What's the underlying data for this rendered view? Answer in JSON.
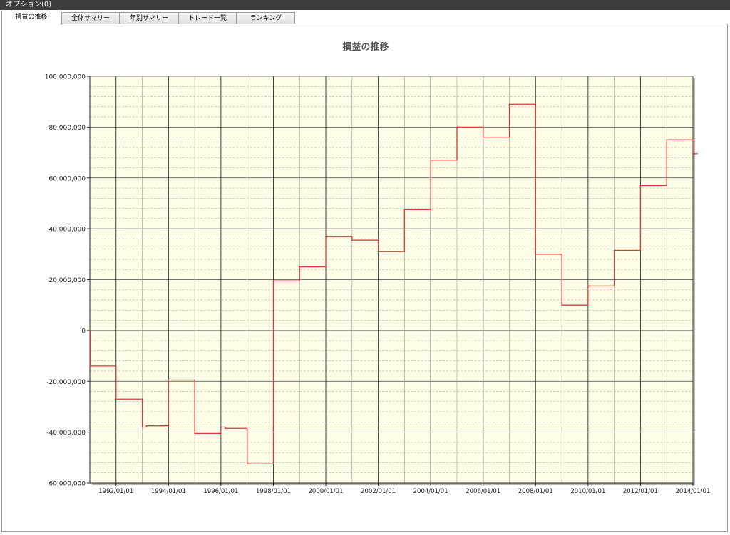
{
  "window": {
    "title": "オプション(0)"
  },
  "tabs": [
    {
      "label": "損益の推移",
      "active": true
    },
    {
      "label": "全体サマリー",
      "active": false
    },
    {
      "label": "年別サマリー",
      "active": false
    },
    {
      "label": "トレード一覧",
      "active": false
    },
    {
      "label": "ランキング",
      "active": false
    }
  ],
  "colors": {
    "plot_background": "#fdfde8",
    "line": "#d93a3a",
    "titlebar": "#3c3c3c"
  },
  "chart_data": {
    "type": "line",
    "title": "損益の推移",
    "xlabel": "",
    "ylabel": "",
    "x_range": [
      "1991/01/01",
      "2014/01/01"
    ],
    "ylim": [
      -60000000,
      100000000
    ],
    "y_ticks": [
      100000000,
      80000000,
      60000000,
      40000000,
      20000000,
      0,
      -20000000,
      -40000000,
      -60000000
    ],
    "y_tick_labels": [
      "100,000,000",
      "80,000,000",
      "60,000,000",
      "40,000,000",
      "20,000,000",
      "0",
      "-20,000,000",
      "-40,000,000",
      "-60,000,000"
    ],
    "x_ticks": [
      "1992/01/01",
      "1994/01/01",
      "1996/01/01",
      "1998/01/01",
      "2000/01/01",
      "2002/01/01",
      "2004/01/01",
      "2006/01/01",
      "2008/01/01",
      "2010/01/01",
      "2012/01/01",
      "2014/01/01"
    ],
    "grid": true,
    "legend": "none",
    "step": "post",
    "series": [
      {
        "points": [
          {
            "x": "1991/01/01",
            "y": 0
          },
          {
            "x": "1991/01/05",
            "y": -14000000
          },
          {
            "x": "1992/01/01",
            "y": -27000000
          },
          {
            "x": "1993/01/01",
            "y": -38000000
          },
          {
            "x": "1993/03/01",
            "y": -37500000
          },
          {
            "x": "1994/01/01",
            "y": -19500000
          },
          {
            "x": "1995/01/01",
            "y": -40500000
          },
          {
            "x": "1996/01/01",
            "y": -38000000
          },
          {
            "x": "1996/03/01",
            "y": -38500000
          },
          {
            "x": "1997/01/01",
            "y": -52500000
          },
          {
            "x": "1998/01/01",
            "y": 19500000
          },
          {
            "x": "1999/01/01",
            "y": 25000000
          },
          {
            "x": "2000/01/01",
            "y": 37000000
          },
          {
            "x": "2001/01/01",
            "y": 35500000
          },
          {
            "x": "2002/01/01",
            "y": 31000000
          },
          {
            "x": "2003/01/01",
            "y": 47500000
          },
          {
            "x": "2004/01/01",
            "y": 67000000
          },
          {
            "x": "2005/01/01",
            "y": 80000000
          },
          {
            "x": "2006/01/01",
            "y": 76000000
          },
          {
            "x": "2007/01/01",
            "y": 89000000
          },
          {
            "x": "2008/01/01",
            "y": 30000000
          },
          {
            "x": "2009/01/01",
            "y": 10000000
          },
          {
            "x": "2010/01/01",
            "y": 17500000
          },
          {
            "x": "2011/01/01",
            "y": 31500000
          },
          {
            "x": "2012/01/01",
            "y": 57000000
          },
          {
            "x": "2013/01/01",
            "y": 75000000
          },
          {
            "x": "2014/01/01",
            "y": 69500000
          },
          {
            "x": "2014/03/01",
            "y": 69500000
          }
        ]
      }
    ]
  }
}
